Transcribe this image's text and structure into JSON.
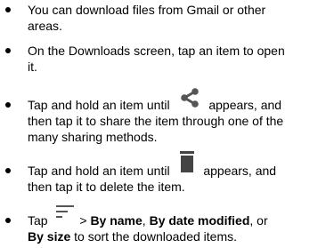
{
  "items": [
    {
      "lines": [
        "You can download files from Gmail or other",
        "areas."
      ]
    },
    {
      "lines": [
        "On the Downloads screen, tap an item to open",
        "it."
      ]
    },
    {
      "line1_before": "Tap and hold an item until",
      "line1_after": " appears, and",
      "icon": "share-icon",
      "lines_rest": [
        "then tap it to share the item through one of the",
        "many sharing methods."
      ]
    },
    {
      "line1_before": "Tap and hold an item until",
      "line1_after": " appears, and",
      "icon": "trash-icon",
      "lines_rest": [
        "then tap it to delete the item."
      ]
    },
    {
      "tap": "Tap",
      "icon": "sort-icon",
      "after_icon": " > ",
      "by_name": "By name",
      "sep1": ", ",
      "by_date": "By date modified",
      "sep2": ", or",
      "by_size": "By size",
      "line2_rest": " to sort the downloaded items."
    }
  ],
  "colors": {
    "text": "#000000",
    "icon": "#555555"
  }
}
